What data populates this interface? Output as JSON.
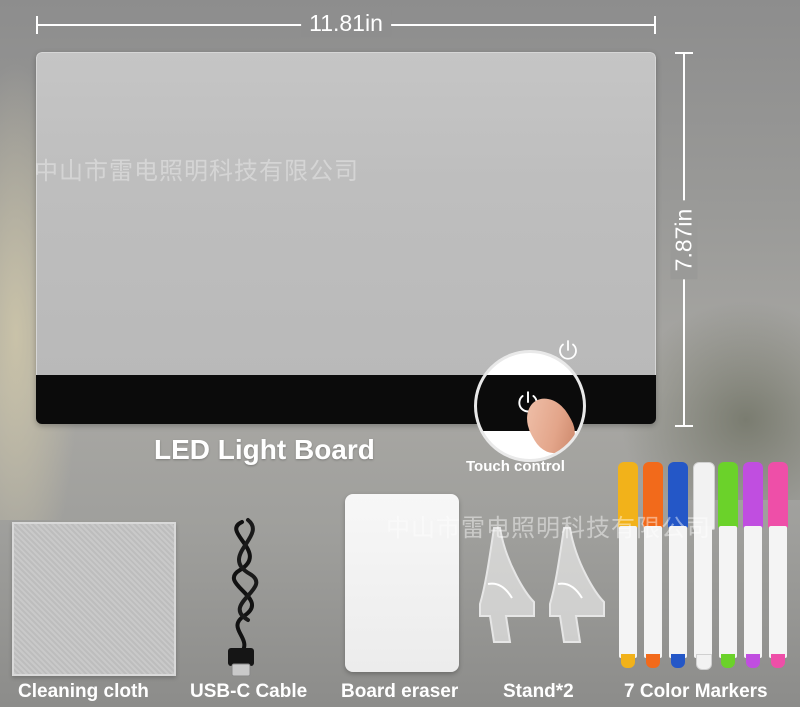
{
  "dimensions": {
    "width_label": "11.81in",
    "height_label": "7.87in"
  },
  "watermark": {
    "text": "中山市雷电照明科技有限公司"
  },
  "product": {
    "title": "LED Light Board",
    "touch_label": "Touch control"
  },
  "accessories": [
    {
      "label": "Cleaning cloth"
    },
    {
      "label": "USB-C Cable"
    },
    {
      "label": "Board eraser"
    },
    {
      "label": "Stand*2"
    },
    {
      "label": "7 Color Markers"
    }
  ],
  "marker_colors": [
    "#f2b21a",
    "#f26a1b",
    "#2457c7",
    "#f2f2f2",
    "#6bd22a",
    "#c04ee0",
    "#ee4fa8"
  ],
  "icons": {
    "power": "power-icon"
  }
}
